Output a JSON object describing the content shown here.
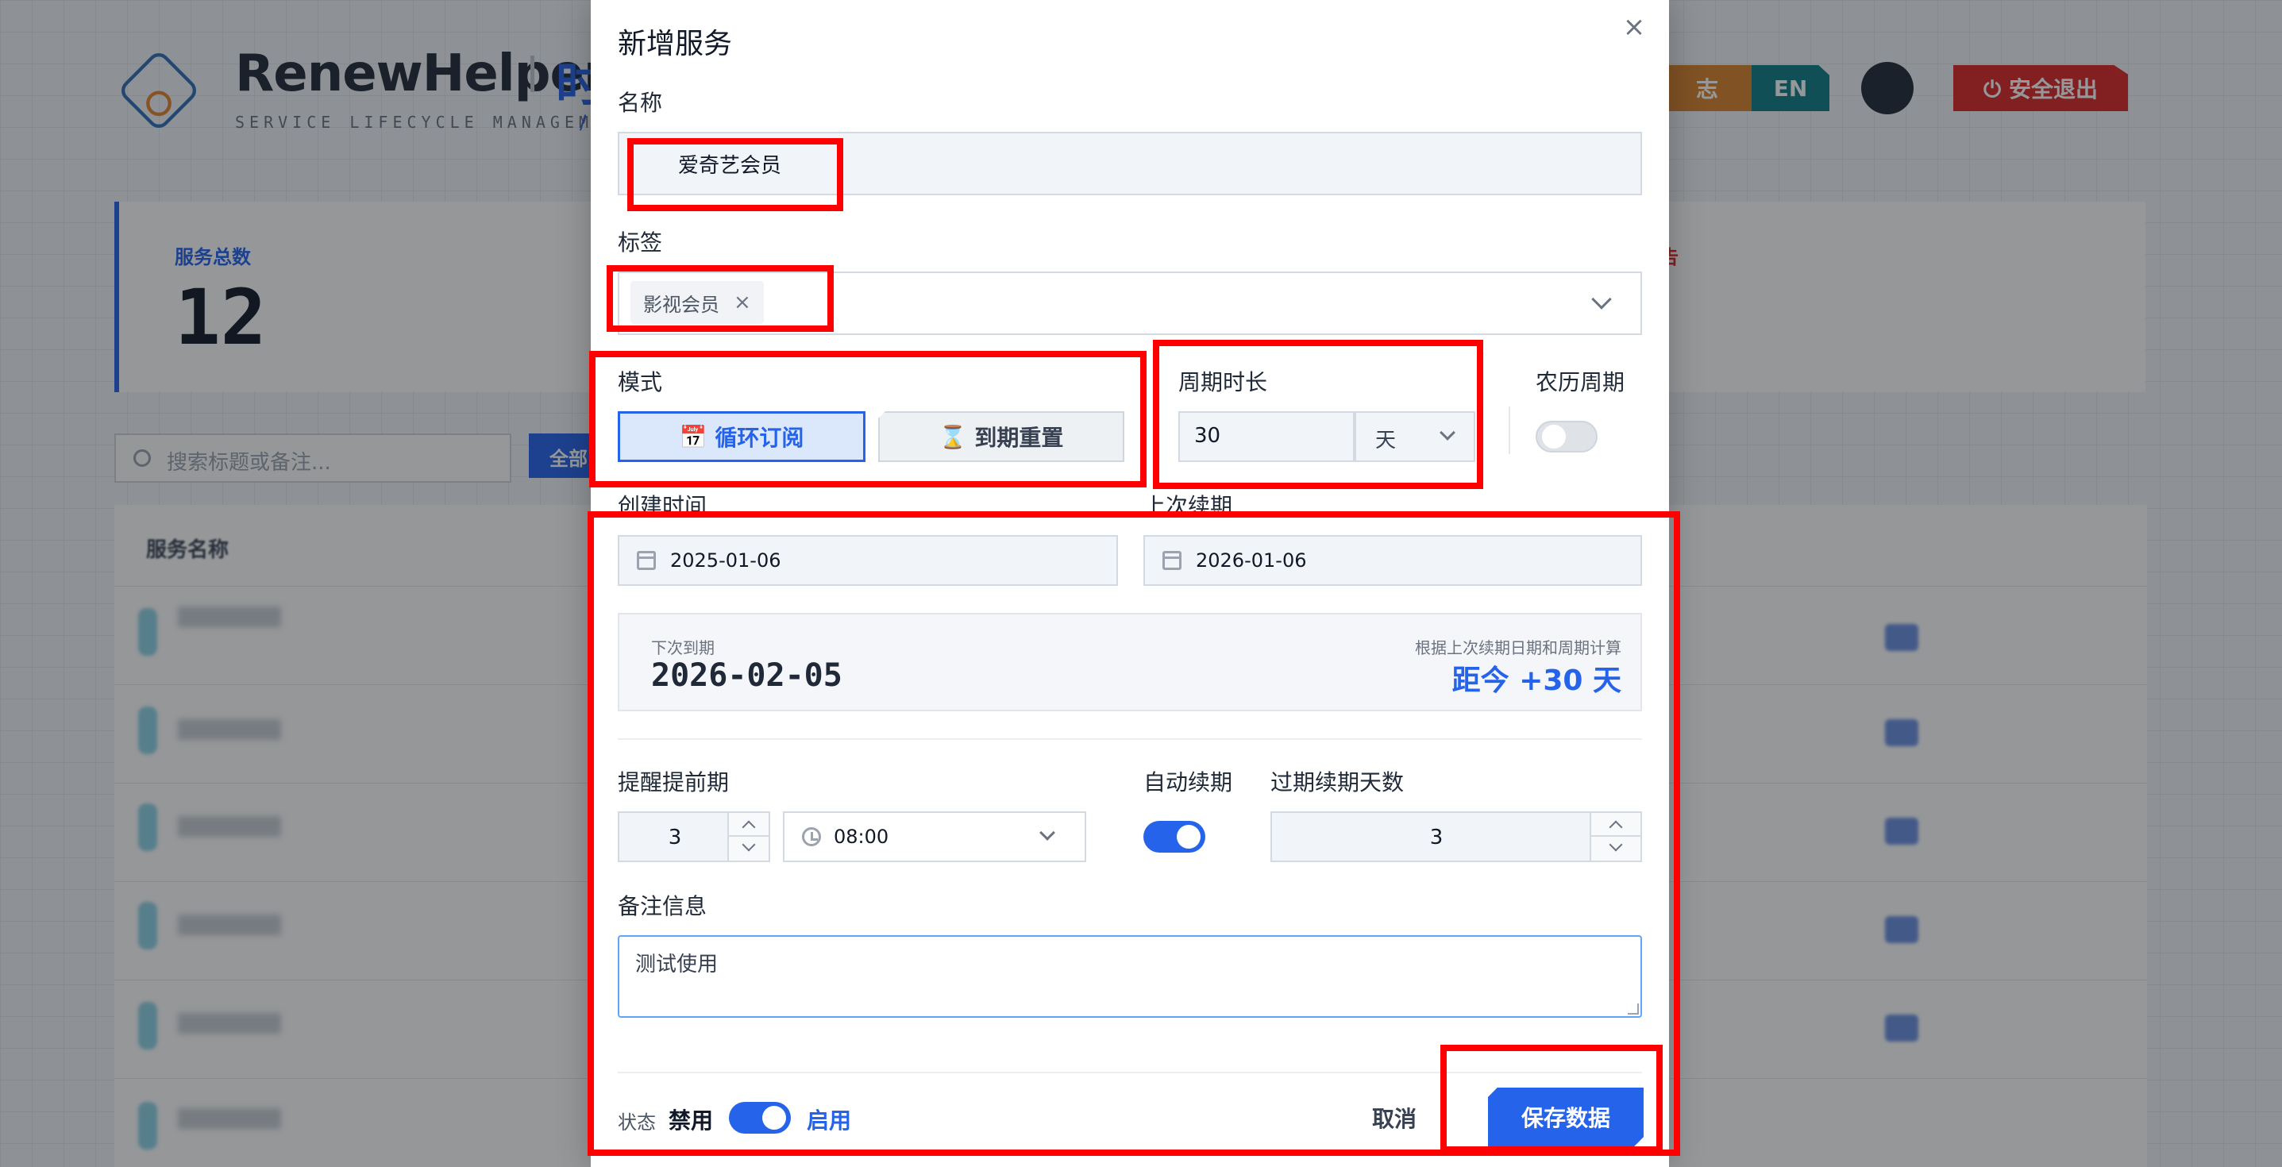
{
  "background": {
    "brand": "RenewHelper",
    "brand_suffix": "时",
    "subtitle": "SERVICE LIFECYCLE MANAGEMENT",
    "subtitle_slash": "/",
    "btn_log": "志",
    "btn_en": "EN",
    "btn_logout": "⏻ 安全退出",
    "card_total_label": "服务总数",
    "card_total_value": "12",
    "card_alert_label": "告",
    "search_placeholder": "搜索标题或备注...",
    "filter_all": "全部",
    "table_header": "服务名称"
  },
  "modal": {
    "title": "新增服务",
    "close_icon": "×",
    "name": {
      "label": "名称",
      "value": "爱奇艺会员"
    },
    "tags": {
      "label": "标签",
      "chips": [
        {
          "label": "影视会员",
          "remove": "×"
        }
      ]
    },
    "mode": {
      "label": "模式",
      "options": [
        {
          "icon": "📅",
          "label": "循环订阅",
          "active": true
        },
        {
          "icon": "⌛",
          "label": "到期重置",
          "active": false
        }
      ]
    },
    "cycle": {
      "label": "周期时长",
      "value": "30",
      "unit": "天"
    },
    "lunar": {
      "label": "农历周期",
      "enabled": false
    },
    "created": {
      "label": "创建时间",
      "value": "2025-01-06"
    },
    "last_renew": {
      "label": "上次续期",
      "value": "2026-01-06"
    },
    "next_due": {
      "label": "下次到期",
      "date": "2026-02-05",
      "hint": "根据上次续期日期和周期计算",
      "countdown": "距今 +30 天"
    },
    "remind": {
      "label": "提醒提前期",
      "days": "3",
      "time": "08:00"
    },
    "auto_renew": {
      "label": "自动续期",
      "enabled": true
    },
    "overdue_days": {
      "label": "过期续期天数",
      "value": "3"
    },
    "notes": {
      "label": "备注信息",
      "value": "测试使用"
    },
    "status": {
      "label": "状态",
      "off_label": "禁用",
      "on_label": "启用",
      "enabled": true
    },
    "cancel_label": "取消",
    "save_label": "保存数据"
  },
  "colors": {
    "accent": "#2563eb",
    "annotation": "#ff0000",
    "danger": "#dc2626"
  }
}
